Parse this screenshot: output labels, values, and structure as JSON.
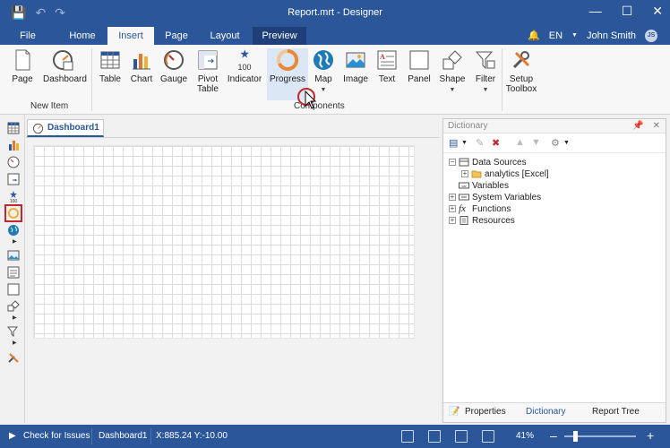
{
  "window": {
    "title": "Report.mrt - Designer"
  },
  "menu_tabs": [
    {
      "label": "File"
    },
    {
      "label": "Home"
    },
    {
      "label": "Insert"
    },
    {
      "label": "Page"
    },
    {
      "label": "Layout"
    },
    {
      "label": "Preview"
    }
  ],
  "user": {
    "language": "EN",
    "name": "John Smith",
    "initials": "JS"
  },
  "ribbon": {
    "buttons": [
      {
        "label": "Page"
      },
      {
        "label": "Dashboard"
      },
      {
        "label": "Table"
      },
      {
        "label": "Chart"
      },
      {
        "label": "Gauge"
      },
      {
        "label": "Pivot\nTable",
        "l1": "Pivot",
        "l2": "Table"
      },
      {
        "label": "Indicator",
        "value_text": "100"
      },
      {
        "label": "Progress"
      },
      {
        "label": "Map"
      },
      {
        "label": "Image"
      },
      {
        "label": "Text"
      },
      {
        "label": "Panel"
      },
      {
        "label": "Shape"
      },
      {
        "label": "Filter"
      },
      {
        "label": "Setup Toolbox",
        "l1": "Setup",
        "l2": "Toolbox"
      }
    ],
    "groups": {
      "new_item": "New Item",
      "components": "Components"
    }
  },
  "document": {
    "tab_label": "Dashboard1"
  },
  "dictionary": {
    "title": "Dictionary",
    "tree": [
      {
        "label": "Data Sources"
      },
      {
        "label": "analytics [Excel]"
      },
      {
        "label": "Variables"
      },
      {
        "label": "System Variables"
      },
      {
        "label": "Functions"
      },
      {
        "label": "Resources"
      }
    ],
    "bottom_tabs": [
      {
        "label": "Properties"
      },
      {
        "label": "Dictionary"
      },
      {
        "label": "Report Tree"
      }
    ]
  },
  "status": {
    "check_issues": "Check for Issues",
    "page": "Dashboard1",
    "coords": "X:885.24 Y:-10.00",
    "zoom": "41%"
  },
  "colors": {
    "accent": "#2b579a",
    "highlight": "#c0282d",
    "progress": "#f0a050"
  }
}
